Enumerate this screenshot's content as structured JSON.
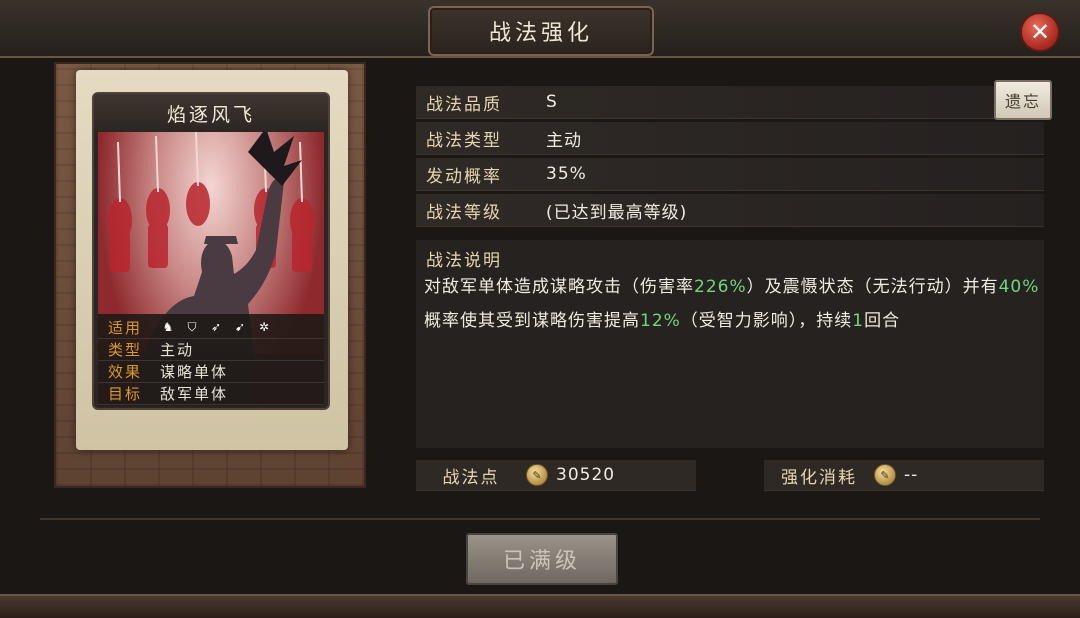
{
  "window": {
    "title": "战法强化",
    "close_icon": "close-icon"
  },
  "card": {
    "name": "焰逐风飞",
    "info": [
      {
        "key": "适用",
        "icons": [
          "cavalry-icon",
          "shield-icon",
          "bow-icon",
          "spear-icon",
          "wheel-icon"
        ]
      },
      {
        "key": "类型",
        "value": "主动"
      },
      {
        "key": "效果",
        "value": "谋略单体"
      },
      {
        "key": "目标",
        "value": "敌军单体"
      }
    ]
  },
  "details": {
    "quality_label": "战法品质",
    "quality_value": "S",
    "type_label": "战法类型",
    "type_value": "主动",
    "rate_label": "发动概率",
    "rate_value": "35%",
    "level_label": "战法等级",
    "level_value": "(已达到最高等级)",
    "legacy_button": "遗忘"
  },
  "description": {
    "title": "战法说明",
    "part1": "对敌军单体造成谋略攻击（伤害率",
    "damage_rate": "226%",
    "part2": "）及震慑状态（无法行动）并有",
    "chance": "40%",
    "part3": "概率使其受到谋略伤害提高",
    "increase": "12%",
    "part4": "（受智力影响），持续",
    "turns": "1",
    "part5": "回合"
  },
  "footer": {
    "points_label": "战法点",
    "points_value": "30520",
    "cost_label": "强化消耗",
    "cost_value": "--",
    "max_button": "已满级"
  },
  "colors": {
    "highlight": "#6fd67a",
    "accent": "#d89a2e"
  }
}
